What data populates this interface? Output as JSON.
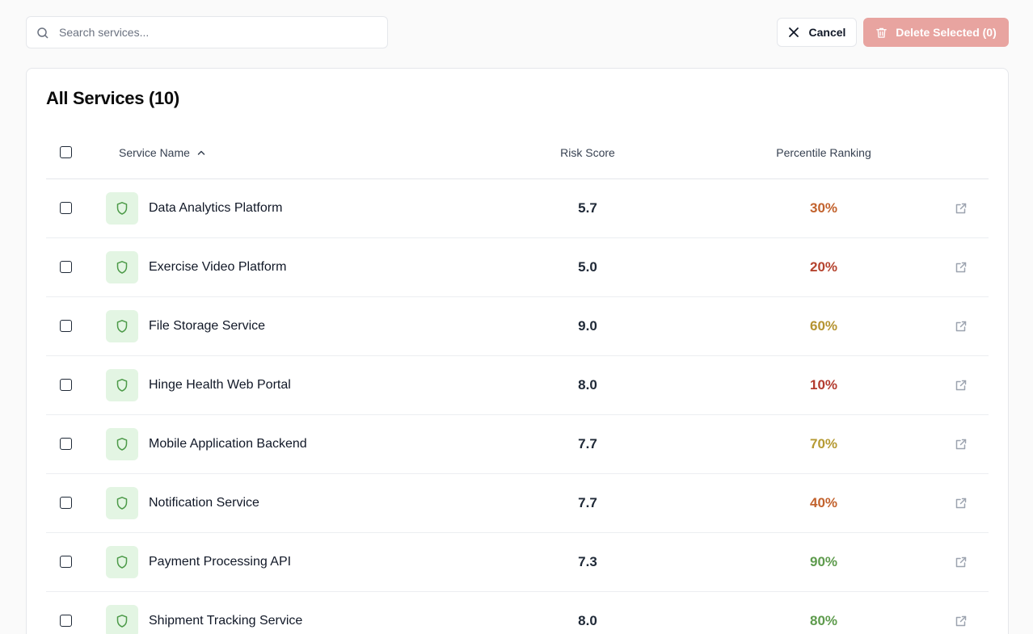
{
  "search": {
    "placeholder": "Search services...",
    "value": ""
  },
  "actions": {
    "cancel_label": "Cancel",
    "delete_label": "Delete Selected (0)"
  },
  "card": {
    "title": "All Services (10)"
  },
  "table": {
    "columns": {
      "name": "Service Name",
      "risk": "Risk Score",
      "percentile": "Percentile Ranking"
    },
    "sort": {
      "column": "name",
      "direction": "ascending"
    },
    "rows": [
      {
        "name": "Data Analytics Platform",
        "risk": "5.7",
        "percentile": "30%",
        "percentile_color": "#c2622d"
      },
      {
        "name": "Exercise Video Platform",
        "risk": "5.0",
        "percentile": "20%",
        "percentile_color": "#b5432e"
      },
      {
        "name": "File Storage Service",
        "risk": "9.0",
        "percentile": "60%",
        "percentile_color": "#b59330"
      },
      {
        "name": "Hinge Health Web Portal",
        "risk": "8.0",
        "percentile": "10%",
        "percentile_color": "#b33b2f"
      },
      {
        "name": "Mobile Application Backend",
        "risk": "7.7",
        "percentile": "70%",
        "percentile_color": "#b59a33"
      },
      {
        "name": "Notification Service",
        "risk": "7.7",
        "percentile": "40%",
        "percentile_color": "#c2622d"
      },
      {
        "name": "Payment Processing API",
        "risk": "7.3",
        "percentile": "90%",
        "percentile_color": "#5e9b4d"
      },
      {
        "name": "Shipment Tracking Service",
        "risk": "8.0",
        "percentile": "80%",
        "percentile_color": "#5e9b4d"
      }
    ]
  },
  "icons": {
    "search": "search-icon",
    "cancel": "close-icon",
    "delete": "trash-icon",
    "service": "shield-icon",
    "sort": "chevron-up-icon",
    "open": "external-link-icon"
  },
  "colors": {
    "shield_bg": "#e3f5e3",
    "shield_stroke": "#4c9a48",
    "delete_bg": "#e8a4a0"
  }
}
